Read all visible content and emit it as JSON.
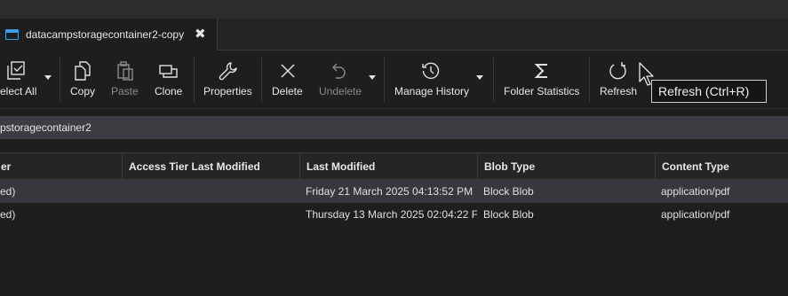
{
  "tab": {
    "title": "datacampstoragecontainer2-copy",
    "close_glyph": "✖"
  },
  "toolbar": {
    "select_all": "elect All",
    "copy": "Copy",
    "paste": "Paste",
    "clone": "Clone",
    "properties": "Properties",
    "delete": "Delete",
    "undelete": "Undelete",
    "manage_history": "Manage History",
    "folder_statistics": "Folder Statistics",
    "refresh": "Refresh"
  },
  "tooltip": {
    "text": "Refresh (Ctrl+R)"
  },
  "path": {
    "text": "pstoragecontainer2"
  },
  "grid": {
    "columns": [
      "er",
      "Access Tier Last Modified",
      "Last Modified",
      "Blob Type",
      "Content Type"
    ],
    "rows": [
      {
        "c0": "ed)",
        "c1": "",
        "c2": "Friday 21 March 2025 04:13:52 PM",
        "c3": "Block Blob",
        "c4": "application/pdf",
        "selected": true
      },
      {
        "c0": "ed)",
        "c1": "",
        "c2": "Thursday 13 March 2025 02:04:22 F",
        "c3": "Block Blob",
        "c4": "application/pdf",
        "selected": false
      }
    ]
  },
  "colors": {
    "background": "#1e1e1e",
    "tab_icon": "#3ba0e6",
    "selected_row": "#37373d"
  }
}
